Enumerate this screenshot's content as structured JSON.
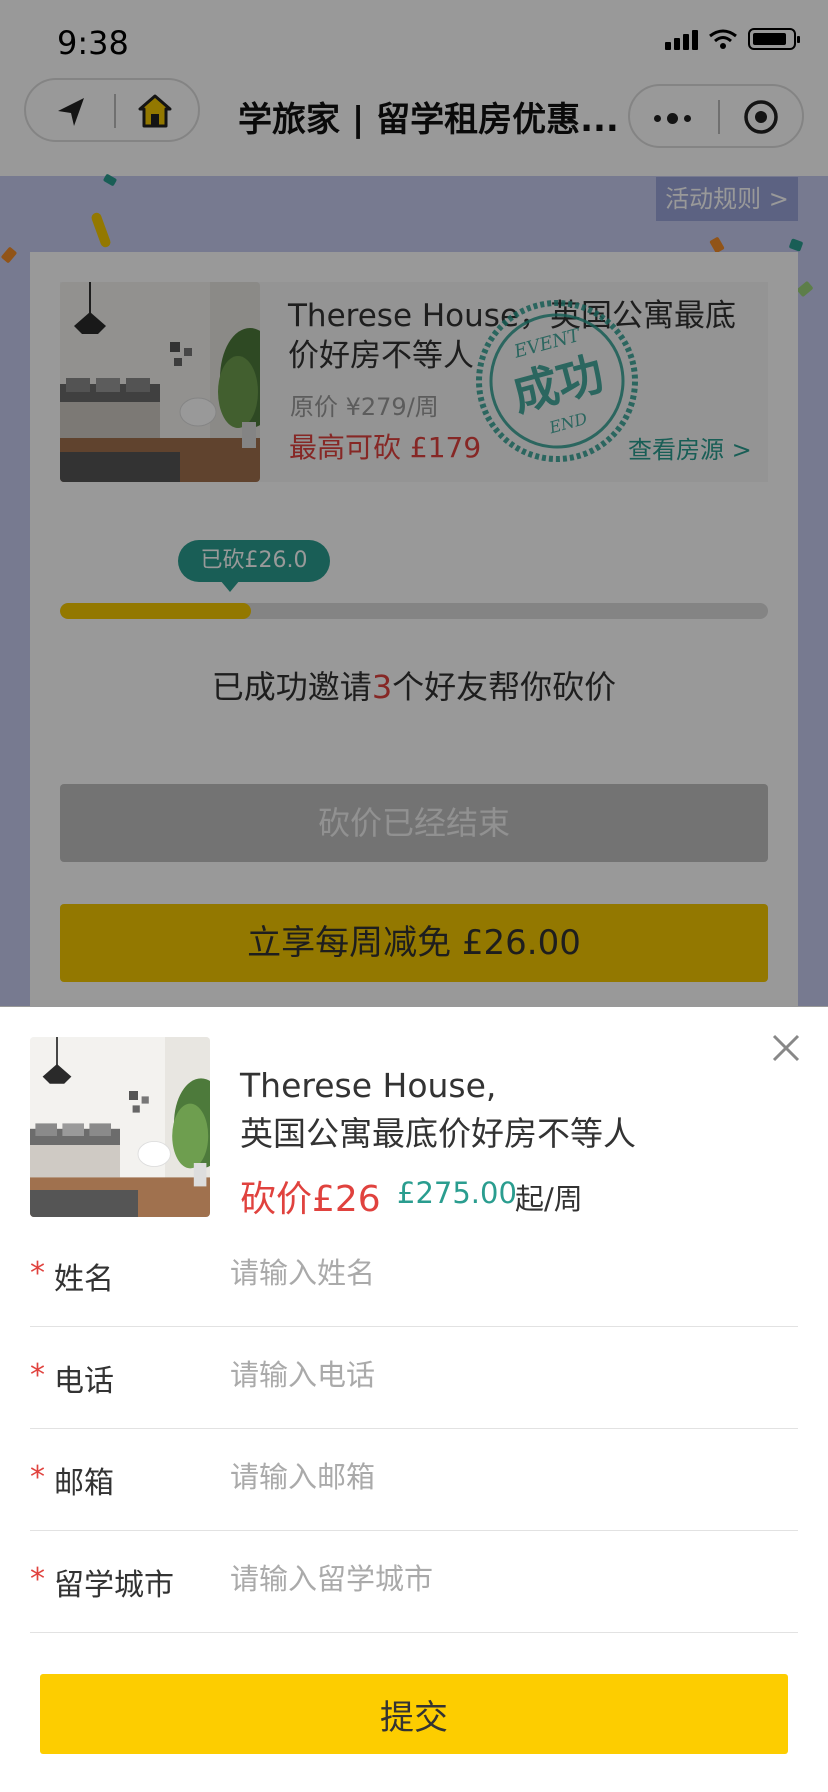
{
  "status_bar": {
    "time": "9:38"
  },
  "nav": {
    "title": "学旅家 | 留学租房优惠..."
  },
  "rules_tag": "活动规则 >",
  "product": {
    "title": "Therese House，英国公寓最底价好房不等人",
    "original_price": "原价 ¥279/周",
    "max_cut": "最高可砍 £179",
    "view_link": "查看房源 >",
    "stamp": {
      "top": "EVENT",
      "main": "成功",
      "bottom": "END"
    }
  },
  "progress": {
    "bubble": "已砍£26.0",
    "fraction": 0.27
  },
  "invite": {
    "before": "已成功邀请",
    "count": "3",
    "after": "个好友帮你砍价"
  },
  "buttons": {
    "ended": "砍价已经结束",
    "enjoy": "立享每周减免 £26.00"
  },
  "sheet": {
    "title_line1": "Therese House,",
    "title_line2": "英国公寓最底价好房不等人",
    "cut": "砍价£26",
    "price": "£275.00",
    "unit": "起/周",
    "fields": [
      {
        "required": "*",
        "label": "姓名",
        "placeholder": "请输入姓名"
      },
      {
        "required": "*",
        "label": "电话",
        "placeholder": "请输入电话"
      },
      {
        "required": "*",
        "label": "邮箱",
        "placeholder": "请输入邮箱"
      },
      {
        "required": "*",
        "label": "留学城市",
        "placeholder": "请输入留学城市"
      }
    ],
    "submit": "提交"
  },
  "colors": {
    "accent_yellow": "#fdcd00",
    "teal": "#2a9d8f",
    "red": "#e0423e",
    "page_bg": "#c6ccf1"
  },
  "icons": [
    "back-icon",
    "home-icon",
    "more-icon",
    "target-icon",
    "close-icon"
  ]
}
